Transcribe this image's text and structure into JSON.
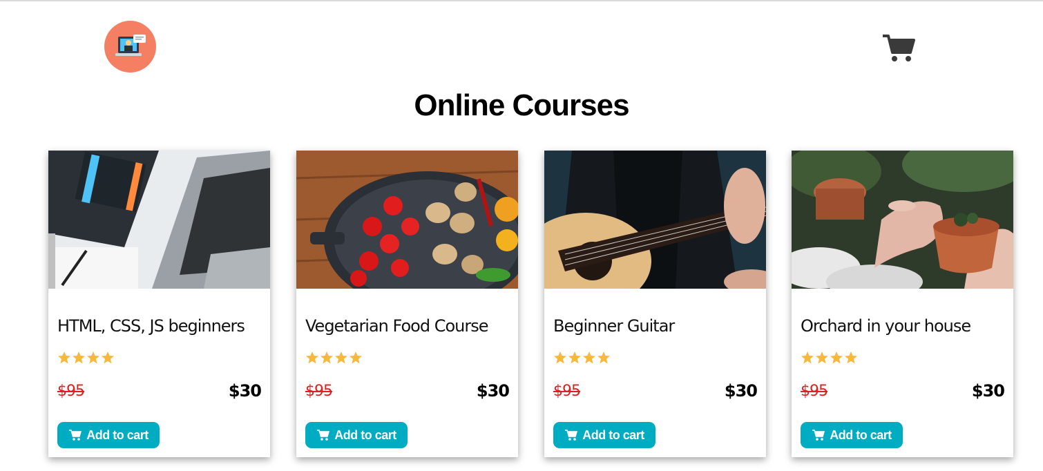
{
  "header": {
    "logo_icon": "laptop-chat-icon",
    "cart_icon": "shopping-cart-icon",
    "title": "Online Courses"
  },
  "colors": {
    "logo_bg": "#f57f63",
    "button": "#00acc1",
    "old_price": "#e02020",
    "star": "#f6b93b"
  },
  "courses": [
    {
      "title": "HTML, CSS, JS beginners",
      "image_icon": "laptop-book-image",
      "rating": 4.5,
      "old_price": "$95",
      "price": "$30",
      "button": "Add to cart"
    },
    {
      "title": "Vegetarian Food Course",
      "image_icon": "vegetable-pan-image",
      "rating": 4.5,
      "old_price": "$95",
      "price": "$30",
      "button": "Add to cart"
    },
    {
      "title": "Beginner Guitar",
      "image_icon": "guitar-player-image",
      "rating": 4.5,
      "old_price": "$95",
      "price": "$30",
      "button": "Add to cart"
    },
    {
      "title": "Orchard in your house",
      "image_icon": "potted-plant-image",
      "rating": 4.5,
      "old_price": "$95",
      "price": "$30",
      "button": "Add to cart"
    }
  ]
}
